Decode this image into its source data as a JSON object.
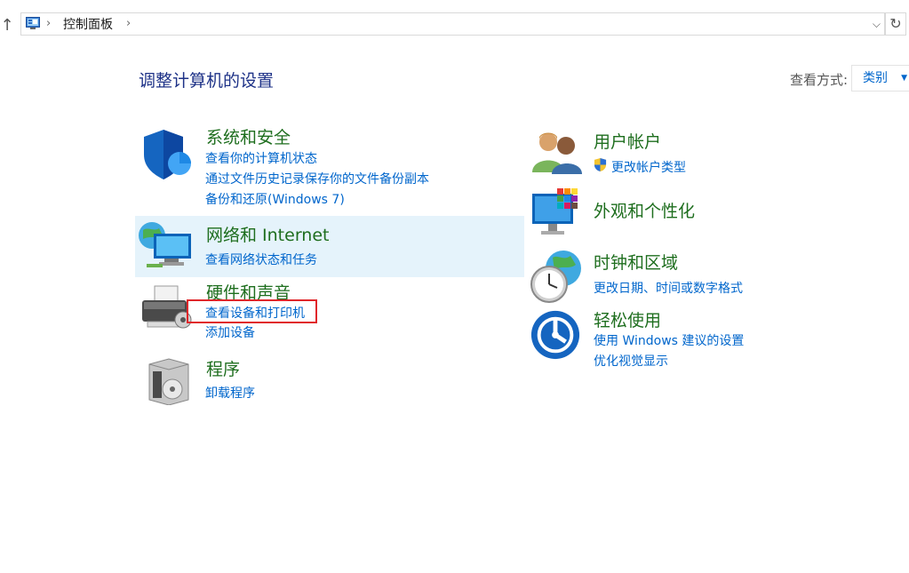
{
  "address_bar": {
    "breadcrumb": "控制面板",
    "up_icon": "up-arrow-icon",
    "refresh_icon": "refresh-icon"
  },
  "header": {
    "title": "调整计算机的设置",
    "view_by_label": "查看方式:",
    "view_by_value": "类别"
  },
  "categories": {
    "system_security": {
      "title": "系统和安全",
      "links": [
        "查看你的计算机状态",
        "通过文件历史记录保存你的文件备份副本",
        "备份和还原(Windows 7)"
      ]
    },
    "network": {
      "title": "网络和 Internet",
      "links": [
        "查看网络状态和任务"
      ]
    },
    "hardware": {
      "title": "硬件和声音",
      "links": [
        "查看设备和打印机",
        "添加设备"
      ]
    },
    "programs": {
      "title": "程序",
      "links": [
        "卸载程序"
      ]
    },
    "user_accounts": {
      "title": "用户帐户",
      "links": [
        "更改帐户类型"
      ]
    },
    "appearance": {
      "title": "外观和个性化",
      "links": []
    },
    "clock_region": {
      "title": "时钟和区域",
      "links": [
        "更改日期、时间或数字格式"
      ]
    },
    "ease_of_access": {
      "title": "轻松使用",
      "links": [
        "使用 Windows 建议的设置",
        "优化视觉显示"
      ]
    }
  },
  "colors": {
    "title_green": "#1e6e1e",
    "link_blue": "#0066cc",
    "heading_blue": "#1e3287",
    "highlight_bg": "#e5f3fb",
    "annotation_red": "#e0262a"
  }
}
